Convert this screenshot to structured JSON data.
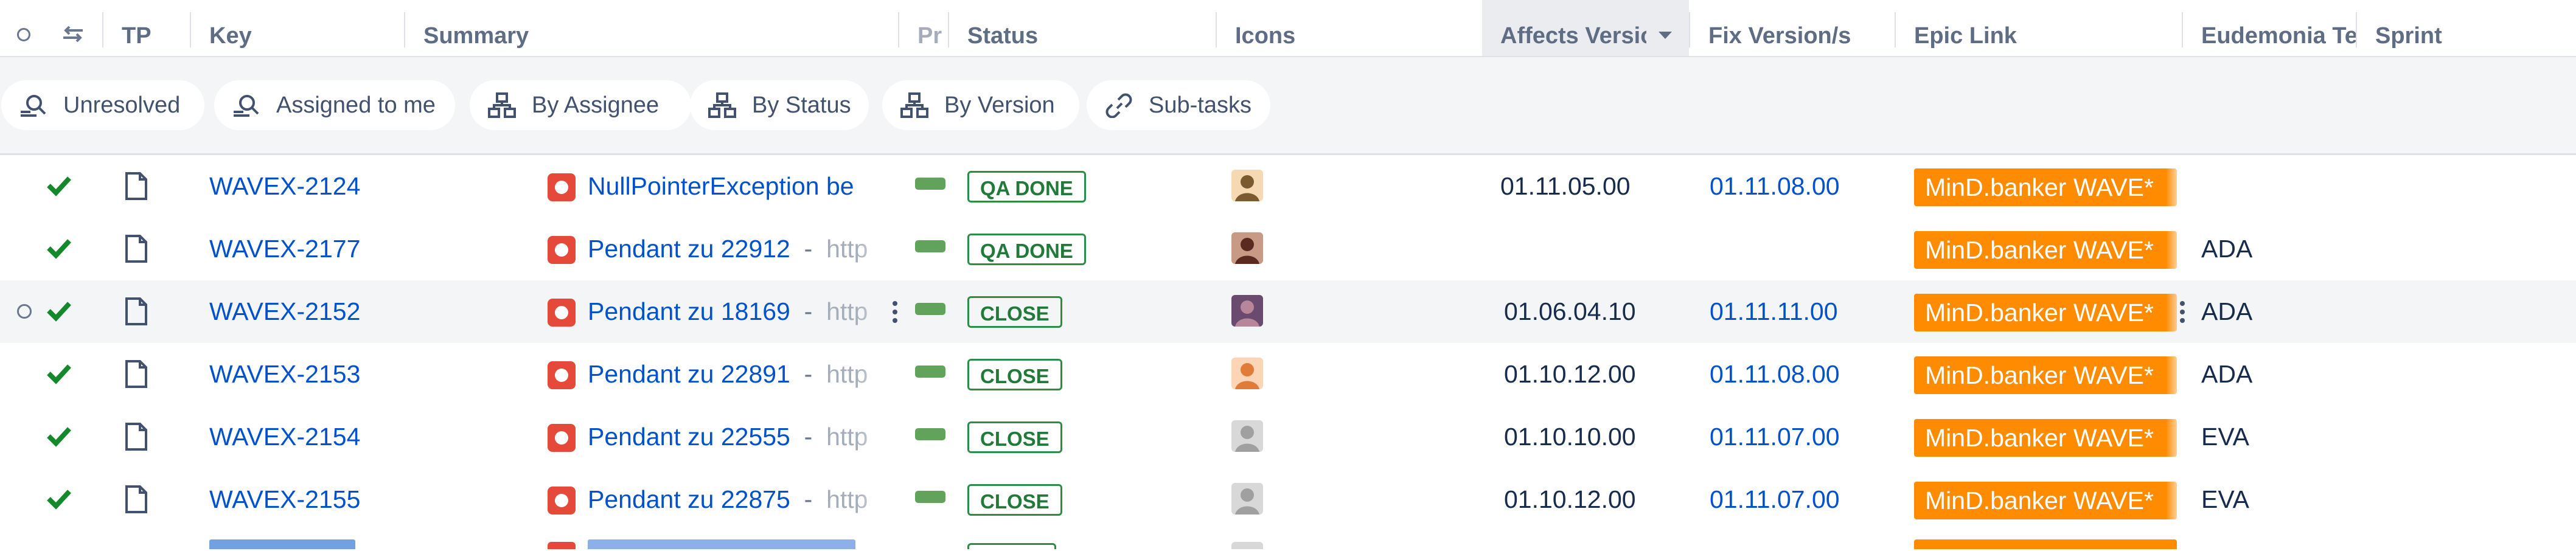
{
  "columns": {
    "tp": "TP",
    "key": "Key",
    "summary": "Summary",
    "priority": "Pr",
    "status": "Status",
    "icons": "Icons",
    "affects": "Affects Versio",
    "fix": "Fix Version/s",
    "epic": "Epic Link",
    "team": "Eudemonia Te",
    "sprint": "Sprint"
  },
  "filters": [
    "Unresolved",
    "Assigned to me",
    "By Assignee",
    "By Status",
    "By Version",
    "Sub-tasks"
  ],
  "rows": [
    {
      "key": "WAVEX-2124",
      "summary": "NullPointerException be",
      "status": "QA DONE",
      "affects": "01.11.05.00",
      "fix": "01.11.08.00",
      "epic": "MinD.banker WAVE*",
      "team": ""
    },
    {
      "key": "WAVEX-2177",
      "summary": "Pendant zu 22912",
      "status": "QA DONE",
      "affects": "",
      "fix": "",
      "epic": "MinD.banker WAVE*",
      "team": "ADA"
    },
    {
      "key": "WAVEX-2152",
      "summary": "Pendant zu 18169",
      "status": "CLOSE",
      "affects": "01.06.04.10",
      "fix": "01.11.11.00",
      "epic": "MinD.banker WAVE*",
      "team": "ADA"
    },
    {
      "key": "WAVEX-2153",
      "summary": "Pendant zu 22891",
      "status": "CLOSE",
      "affects": "01.10.12.00",
      "fix": "01.11.08.00",
      "epic": "MinD.banker WAVE*",
      "team": "ADA"
    },
    {
      "key": "WAVEX-2154",
      "summary": "Pendant zu 22555",
      "status": "CLOSE",
      "affects": "01.10.10.00",
      "fix": "01.11.07.00",
      "epic": "MinD.banker WAVE*",
      "team": "EVA"
    },
    {
      "key": "WAVEX-2155",
      "summary": "Pendant zu 22875",
      "status": "CLOSE",
      "affects": "01.10.12.00",
      "fix": "01.11.07.00",
      "epic": "MinD.banker WAVE*",
      "team": "EVA"
    }
  ],
  "summary_link_text": "http",
  "summary_separator": "-",
  "colors": {
    "epic": "#ff8b00",
    "status_done": "#2c8d45",
    "link": "#0052cc",
    "bug": "#e5493a",
    "priority": "#61a35a"
  }
}
